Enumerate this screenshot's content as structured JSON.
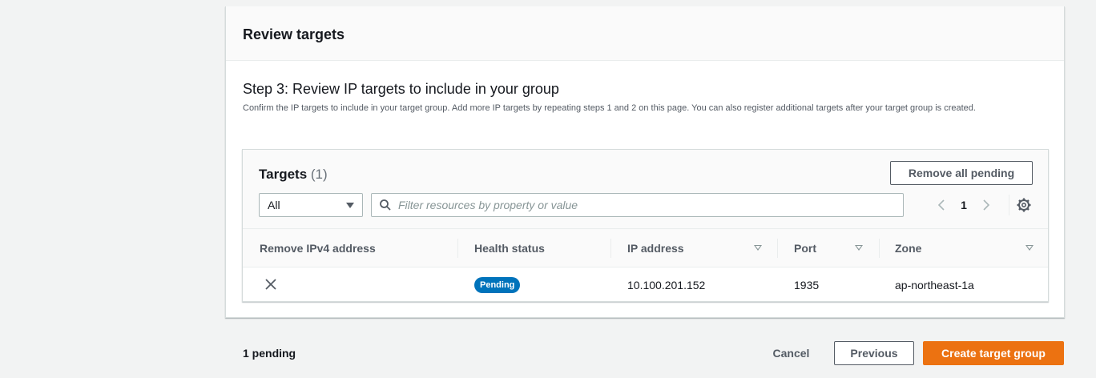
{
  "panel": {
    "title": "Review targets",
    "step_title": "Step 3: Review IP targets to include in your group",
    "step_description": "Confirm the IP targets to include in your target group. Add more IP targets by repeating steps 1 and 2 on this page. You can also register additional targets after your target group is created."
  },
  "targets": {
    "title": "Targets",
    "count": "(1)",
    "remove_all_label": "Remove all pending",
    "filter_select_value": "All",
    "filter_placeholder": "Filter resources by property or value",
    "page_number": "1",
    "columns": [
      "Remove IPv4 address",
      "Health status",
      "IP address",
      "Port",
      "Zone"
    ],
    "rows": [
      {
        "health_status": "Pending",
        "ip_address": "10.100.201.152",
        "port": "1935",
        "zone": "ap-northeast-1a"
      }
    ]
  },
  "footer": {
    "pending_text": "1 pending",
    "cancel_label": "Cancel",
    "previous_label": "Previous",
    "create_label": "Create target group"
  },
  "colors": {
    "primary_button": "#ec7211",
    "badge_pending": "#0073bb",
    "page_background": "#f2f3f3"
  },
  "icons": [
    "search-icon",
    "chevron-left-icon",
    "chevron-right-icon",
    "gear-icon",
    "close-icon",
    "caret-down-icon",
    "sort-icon"
  ]
}
